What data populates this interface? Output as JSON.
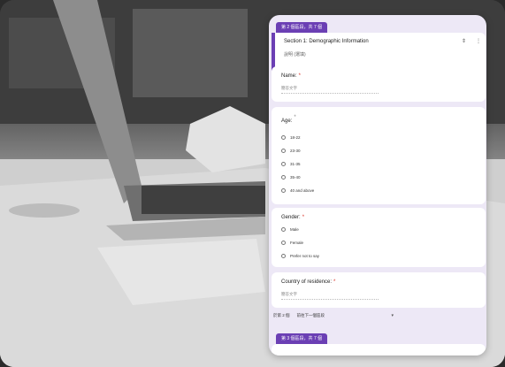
{
  "section2_tag": "第 2 個區段，共 7 個",
  "section": {
    "title": "Section 1: Demographic Information",
    "description": "說明 (選填)",
    "move_icon": "updown-arrows-icon",
    "more_icon": "more-vert-icon"
  },
  "questions": [
    {
      "title": "Name:",
      "required": "*",
      "placeholder": "簡答文字"
    },
    {
      "title": "Age:",
      "required": "*",
      "options": [
        "18-22",
        "23-30",
        "31-35",
        "35-40",
        "40 and above"
      ]
    },
    {
      "title": "Gender:",
      "required": "*",
      "options": [
        "Male",
        "Female",
        "Prefer not to say"
      ]
    },
    {
      "title": "Country of residence:",
      "required": "*",
      "placeholder": "簡答文字"
    }
  ],
  "after_section": {
    "label": "於第 2 個",
    "select_value": "前往下一個區段"
  },
  "section3_tag": "第 3 個區段，共 7 個",
  "colors": {
    "accent": "#6b3fb4",
    "panel_bg": "#ede8f6",
    "required": "#d93025"
  }
}
